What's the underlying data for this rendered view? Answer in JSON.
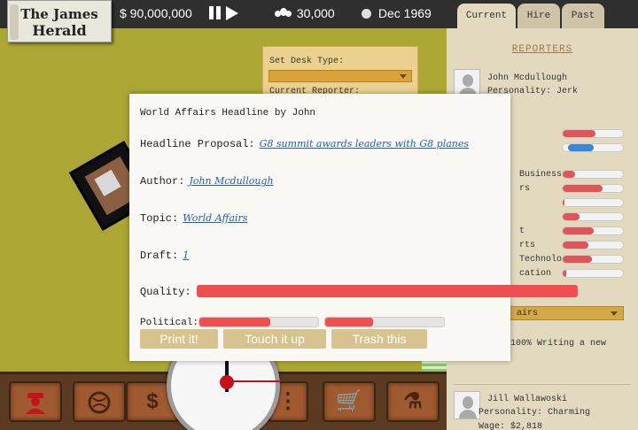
{
  "header": {
    "logo_line1": "The James",
    "logo_line2": "Herald",
    "money": "$ 90,000,000",
    "employees": "30,000",
    "date": "Dec 1969"
  },
  "office": {
    "desk_type_label": "Set Desk Type:",
    "current_reporter_label": "Current Reporter:"
  },
  "bottom_toolbar": {
    "money_symbol": "$",
    "more_symbol": "⋮",
    "cart_symbol": "🛒",
    "flask_symbol": "⚗"
  },
  "right_panel": {
    "tabs": [
      "Current",
      "Hire",
      "Past"
    ],
    "section_title": "REPORTERS",
    "reporter1": {
      "name": "John Mcdullough",
      "personality": "Personality: Jerk",
      "skill_labels": [
        "Business",
        "rs",
        "t",
        "rts",
        "Technology",
        "cation"
      ],
      "skill_levels": [
        0.2,
        0.66,
        0.03,
        0.28,
        0.52,
        0.42,
        0.48,
        0.06
      ],
      "top_bar_levels": [
        0.55,
        0.42
      ],
      "beat_fragment": "airs",
      "writing_fragment": "100% Writing a new"
    },
    "reporter2": {
      "name": "Jill Wallawoski",
      "personality": "Personality: Charming",
      "wage": "Wage: $2,818"
    }
  },
  "modal": {
    "title": "World Affairs Headline by John",
    "headline_label": "Headline Proposal:",
    "headline_value": "G8 summit awards leaders with G8 planes",
    "author_label": "Author:",
    "author_value": "John Mcdullough",
    "topic_label": "Topic:",
    "topic_value": "World Affairs",
    "draft_label": "Draft:",
    "draft_value": "1",
    "quality_label": "Quality:",
    "quality_level": 1.0,
    "political_label": "Political:",
    "political_levels": [
      0.6,
      0.4
    ],
    "buttons": {
      "print": "Print it!",
      "touch": "Touch it up",
      "trash": "Trash this"
    }
  }
}
